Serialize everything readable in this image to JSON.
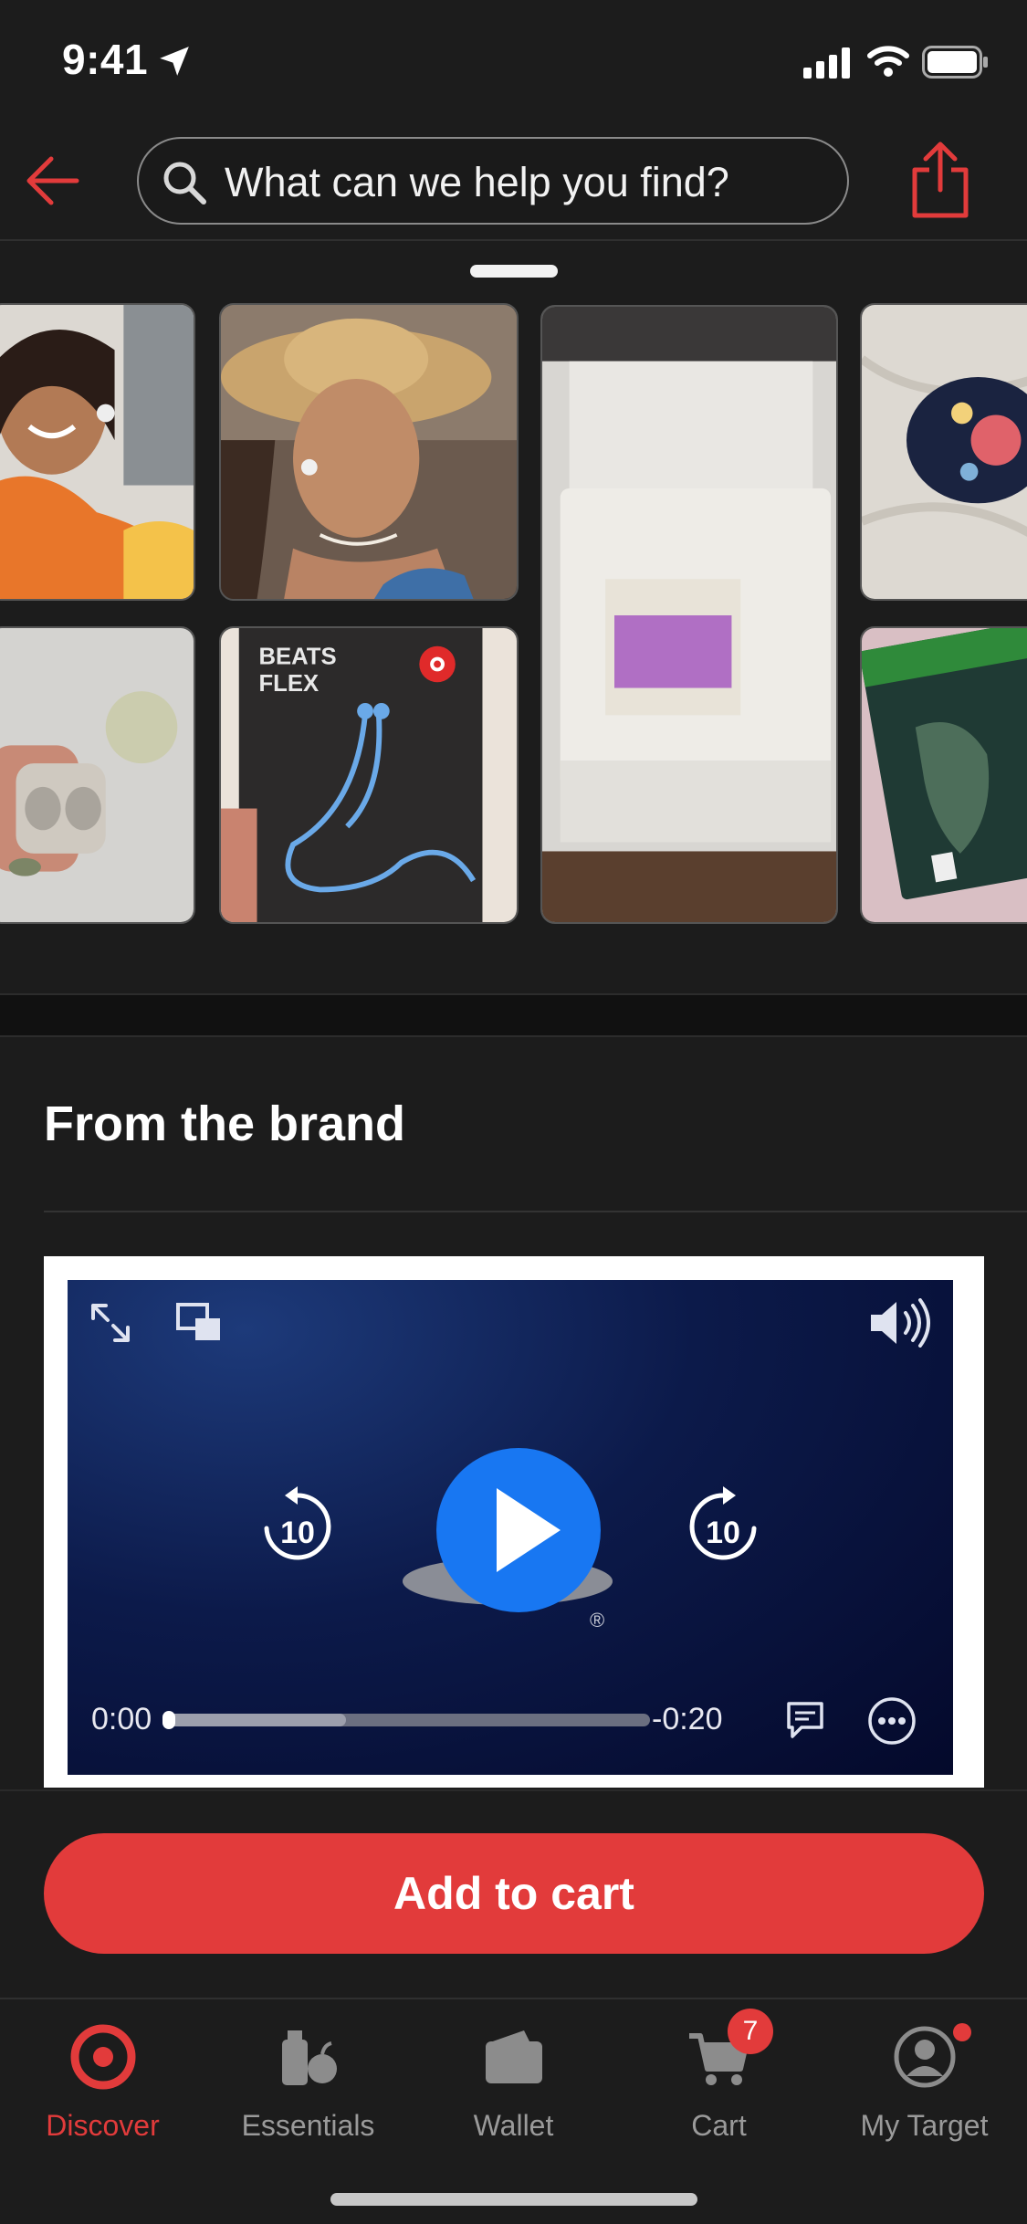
{
  "status_bar": {
    "time": "9:41"
  },
  "search": {
    "placeholder": "What can we help you find?"
  },
  "gallery": {
    "items": [
      {
        "name": "woman-orange-sweater-earbuds-photo"
      },
      {
        "name": "woman-cowboy-hat-earbuds-photo"
      },
      {
        "name": "printer-photo"
      },
      {
        "name": "floral-mouse-photo"
      },
      {
        "name": "bose-earbuds-case-photo"
      },
      {
        "name": "beats-flex-box-photo",
        "box_text_line1": "BEATS",
        "box_text_line2": "FLEX"
      },
      {
        "name": "halo-game-case-photo"
      }
    ]
  },
  "section": {
    "title": "From the brand"
  },
  "video": {
    "current_time": "0:00",
    "remaining_time": "-0:20",
    "skip_back": "10",
    "skip_forward": "10",
    "buffered_fraction": 0.37,
    "played_fraction": 0.0
  },
  "cart_action": {
    "label": "Add to cart"
  },
  "tabs": [
    {
      "label": "Discover",
      "icon": "target-logo-icon",
      "active": true
    },
    {
      "label": "Essentials",
      "icon": "essentials-icon"
    },
    {
      "label": "Wallet",
      "icon": "wallet-icon"
    },
    {
      "label": "Cart",
      "icon": "cart-icon",
      "badge": "7"
    },
    {
      "label": "My Target",
      "icon": "profile-icon",
      "dot": true
    }
  ],
  "colors": {
    "accent": "#e23b3b",
    "background": "#1c1c1c",
    "play_button": "#1877f2"
  }
}
